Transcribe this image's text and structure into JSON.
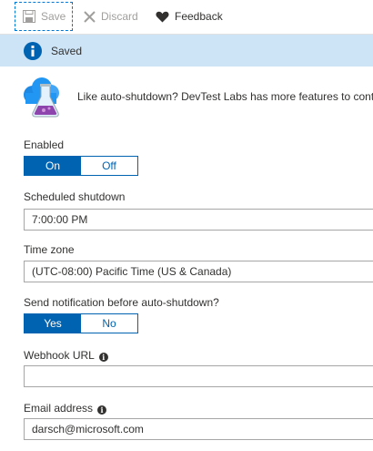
{
  "toolbar": {
    "save_label": "Save",
    "discard_label": "Discard",
    "feedback_label": "Feedback"
  },
  "banner": {
    "message": "Saved",
    "icon": "info-icon"
  },
  "promo": {
    "icon": "devtest-labs-flask-cloud-icon",
    "text": "Like auto-shutdown? DevTest Labs has more features to control"
  },
  "form": {
    "enabled": {
      "label": "Enabled",
      "options": [
        "On",
        "Off"
      ],
      "selected": "On"
    },
    "scheduled_shutdown": {
      "label": "Scheduled shutdown",
      "value": "7:00:00 PM"
    },
    "time_zone": {
      "label": "Time zone",
      "value": "(UTC-08:00) Pacific Time (US & Canada)"
    },
    "send_notification": {
      "label": "Send notification before auto-shutdown?",
      "options": [
        "Yes",
        "No"
      ],
      "selected": "Yes"
    },
    "webhook_url": {
      "label": "Webhook URL",
      "value": ""
    },
    "email_address": {
      "label": "Email address",
      "value": "darsch@microsoft.com"
    }
  },
  "colors": {
    "accent": "#0063b1",
    "banner_bg": "#cce4f6",
    "border": "#a6a6a6"
  }
}
